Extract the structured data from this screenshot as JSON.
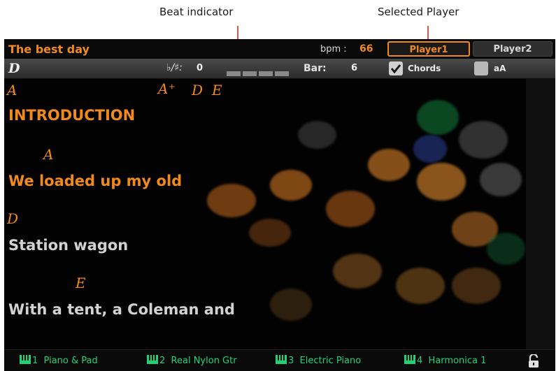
{
  "callouts": {
    "beat_indicator": "Beat indicator",
    "selected_player": "Selected Player"
  },
  "header": {
    "song_title": "The best day",
    "bpm_label": "bpm :",
    "bpm_value": "66",
    "player1": "Player1",
    "player2": "Player2"
  },
  "infobar": {
    "key": "D",
    "transpose_label": "♭/♯:",
    "transpose_value": "0",
    "beat_segments": 4,
    "bar_label": "Bar:",
    "bar_value": "6",
    "chords_label": "Chords",
    "chords_checked": true,
    "aa_label": "aA",
    "aa_checked": false
  },
  "lyrics": {
    "chords_line1": [
      "A",
      "A⁺",
      "D",
      "E"
    ],
    "intro": "INTRODUCTION",
    "chord_a": "A",
    "line1": "We loaded up my old",
    "chord_d": "D",
    "line2": "Station wagon",
    "chord_e": "E",
    "line3": "With a tent, a Coleman and"
  },
  "footer": {
    "tracks": [
      {
        "num": "1",
        "name": "Piano & Pad"
      },
      {
        "num": "2",
        "name": "Real Nylon Gtr"
      },
      {
        "num": "3",
        "name": "Electric Piano"
      },
      {
        "num": "4",
        "name": "Harmonica 1"
      }
    ]
  },
  "colors": {
    "accent": "#f08a1c",
    "track_green": "#1fd27a",
    "leader": "#e2553a"
  }
}
